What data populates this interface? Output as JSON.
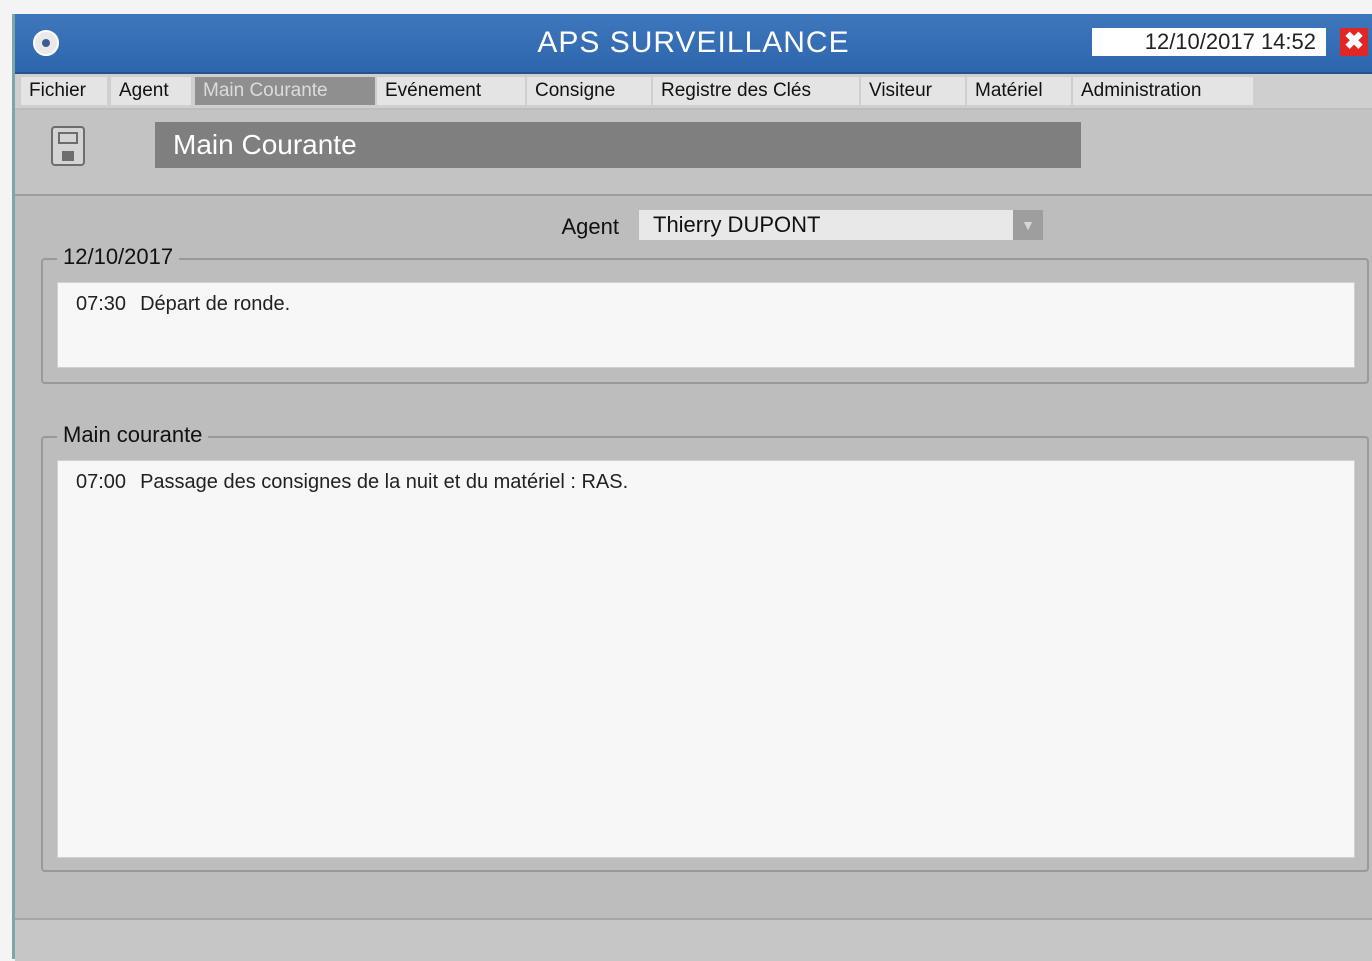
{
  "window": {
    "title": "APS SURVEILLANCE",
    "datetime": "12/10/2017  14:52",
    "close_symbol": "✖"
  },
  "menu": {
    "items": [
      {
        "label": "Fichier"
      },
      {
        "label": "Agent"
      },
      {
        "label": "Main Courante",
        "active": true
      },
      {
        "label": "Evénement"
      },
      {
        "label": "Consigne"
      },
      {
        "label": "Registre des Clés"
      },
      {
        "label": "Visiteur"
      },
      {
        "label": "Matériel"
      },
      {
        "label": "Administration"
      }
    ]
  },
  "toolbar": {
    "save_icon": "floppy-disk-icon",
    "page_title": "Main Courante"
  },
  "agent": {
    "label": "Agent",
    "selected": "Thierry DUPONT"
  },
  "day_group": {
    "legend": "12/10/2017",
    "entries": [
      {
        "time": "07:30",
        "text": "Départ de ronde."
      }
    ]
  },
  "main_group": {
    "legend": "Main courante",
    "entries": [
      {
        "time": "07:00",
        "text": "Passage des consignes de la nuit et du matériel : RAS."
      }
    ]
  },
  "colors": {
    "titlebar": "#2e66ad",
    "window_bg": "#bdbdbd",
    "active_menu": "#8f8f8f",
    "close_button": "#e12626"
  }
}
